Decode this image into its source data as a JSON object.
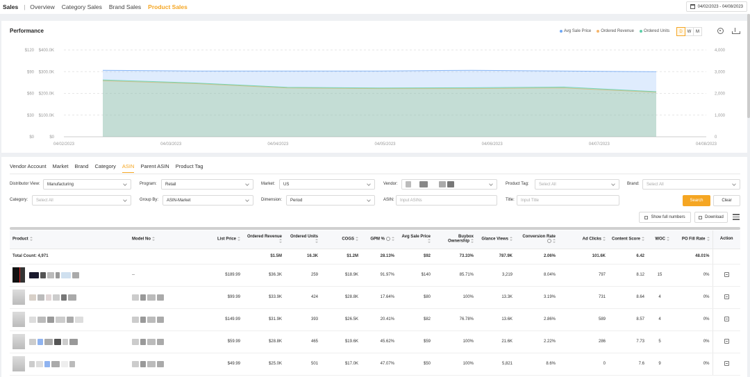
{
  "topnav": {
    "title": "Sales",
    "items": [
      "Overview",
      "Category Sales",
      "Brand Sales",
      "Product Sales"
    ],
    "active": "Product Sales",
    "date_range": "04/02/2023 - 04/08/2023"
  },
  "performance": {
    "title": "Performance",
    "legend": [
      {
        "label": "Avg Sale Price",
        "color": "#6fa8f5"
      },
      {
        "label": "Ordered Revenue",
        "color": "#f5b56b"
      },
      {
        "label": "Ordered Units",
        "color": "#5ccfa8"
      }
    ],
    "granularity": [
      "D",
      "W",
      "M"
    ],
    "granularity_active": "D"
  },
  "chart_data": {
    "type": "area",
    "x": [
      "04/02/2023",
      "04/03/2023",
      "04/04/2023",
      "04/05/2023",
      "04/06/2023",
      "04/07/2023",
      "04/08/2023"
    ],
    "left_axis_price": {
      "ticks": [
        "$0",
        "$30",
        "$60",
        "$90",
        "$120"
      ],
      "range": [
        0,
        120
      ]
    },
    "left_axis_revenue": {
      "ticks": [
        "$0",
        "$100.0K",
        "$200.0K",
        "$300.0K",
        "$400.0K"
      ],
      "range": [
        0,
        400000
      ]
    },
    "right_axis_units": {
      "ticks": [
        "0",
        "1,000",
        "2,000",
        "3,000",
        "4,000"
      ],
      "range": [
        0,
        4000
      ]
    },
    "series": [
      {
        "name": "Avg Sale Price",
        "axis": "price",
        "color": "#6fa8f5",
        "values": [
          92,
          91,
          91,
          91,
          92,
          91,
          90
        ]
      },
      {
        "name": "Ordered Revenue",
        "axis": "revenue",
        "color": "#f5b56b",
        "values": [
          258000,
          245000,
          225000,
          222000,
          222000,
          225000,
          205000
        ]
      },
      {
        "name": "Ordered Units",
        "axis": "units",
        "color": "#5ccfa8",
        "values": [
          2620,
          2480,
          2280,
          2250,
          2260,
          2290,
          2080
        ]
      }
    ],
    "grid": true
  },
  "filters": {
    "tabs": [
      "Vendor Account",
      "Market",
      "Brand",
      "Category",
      "ASIN",
      "Parent ASIN",
      "Product Tag"
    ],
    "active_tab": "ASIN",
    "distributor_view": {
      "label": "Distributor View:",
      "value": "Manufacturing"
    },
    "program": {
      "label": "Program:",
      "value": "Retail"
    },
    "market": {
      "label": "Market:",
      "value": "US"
    },
    "vendor": {
      "label": "Vendor:",
      "value": ""
    },
    "product_tag": {
      "label": "Product Tag:",
      "placeholder": "Select All"
    },
    "brand": {
      "label": "Brand:",
      "placeholder": "Select All"
    },
    "category": {
      "label": "Category:",
      "placeholder": "Select All"
    },
    "group_by": {
      "label": "Group By:",
      "value": "ASIN-Market"
    },
    "dimension": {
      "label": "Dimension:",
      "value": "Period"
    },
    "asin": {
      "label": "ASIN:",
      "placeholder": "Input ASINs"
    },
    "title": {
      "label": "Title:",
      "placeholder": "Input Title"
    },
    "search_label": "Search",
    "clear_label": "Clear",
    "full_numbers_label": "Show full numbers",
    "download_label": "Download"
  },
  "table": {
    "columns": [
      "Product",
      "Model No",
      "List Price",
      "Ordered Revenue",
      "Ordered Units",
      "COGS",
      "GPM %",
      "Avg Sale Price",
      "Buybox Ownership",
      "Glance Views",
      "Conversion Rate",
      "Ad Clicks",
      "Content Score",
      "WOC",
      "PO Fill Rate",
      "Action"
    ],
    "total": {
      "label": "Total Count: 4,971",
      "ordered_revenue": "$1.5M",
      "ordered_units": "16.3K",
      "cogs": "$1.2M",
      "gpm": "28.13%",
      "avg_sale_price": "$92",
      "buybox": "73.33%",
      "glance_views": "787.9K",
      "conversion": "2.06%",
      "ad_clicks": "101.6K",
      "content_score": "6.42",
      "po_fill_rate": "48.01%"
    },
    "rows": [
      {
        "model": "--",
        "list_price": "$189.99",
        "revenue": "$36.3K",
        "units": "259",
        "cogs": "$18.9K",
        "gpm": "91.97%",
        "asp": "$140",
        "buybox": "85.71%",
        "glance": "3,219",
        "conv": "8.04%",
        "clicks": "797",
        "score": "8.12",
        "woc": "15",
        "fill": "0%"
      },
      {
        "model": "",
        "list_price": "$99.99",
        "revenue": "$33.9K",
        "units": "424",
        "cogs": "$28.8K",
        "gpm": "17.64%",
        "asp": "$80",
        "buybox": "100%",
        "glance": "13.3K",
        "conv": "3.19%",
        "clicks": "731",
        "score": "8.64",
        "woc": "4",
        "fill": "0%"
      },
      {
        "model": "",
        "list_price": "$149.99",
        "revenue": "$31.9K",
        "units": "393",
        "cogs": "$26.5K",
        "gpm": "20.41%",
        "asp": "$82",
        "buybox": "76.78%",
        "glance": "13.6K",
        "conv": "2.86%",
        "clicks": "589",
        "score": "8.57",
        "woc": "4",
        "fill": "0%"
      },
      {
        "model": "",
        "list_price": "$59.99",
        "revenue": "$28.8K",
        "units": "465",
        "cogs": "$19.6K",
        "gpm": "45.62%",
        "asp": "$59",
        "buybox": "100%",
        "glance": "21.6K",
        "conv": "2.22%",
        "clicks": "286",
        "score": "7.73",
        "woc": "5",
        "fill": "0%"
      },
      {
        "model": "",
        "list_price": "$49.99",
        "revenue": "$25.0K",
        "units": "501",
        "cogs": "$17.0K",
        "gpm": "47.07%",
        "asp": "$50",
        "buybox": "100%",
        "glance": "5,821",
        "conv": "8.6%",
        "clicks": "0",
        "score": "7.6",
        "woc": "9",
        "fill": "0%"
      }
    ]
  }
}
